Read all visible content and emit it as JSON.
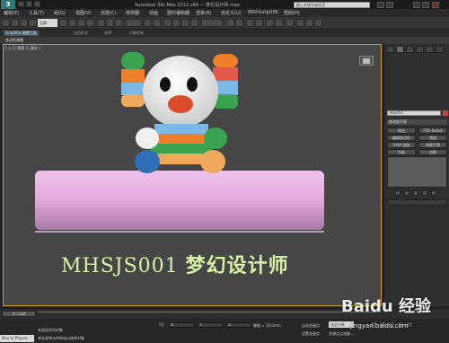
{
  "app": {
    "logo": "3",
    "title": "Autodesk 3ds Max 2012 x64 — 梦幻设计师.max",
    "search_placeholder": "键入关键字或短语"
  },
  "toolbar": {
    "selection_filter": "全部",
    "menus": [
      "编辑(E)",
      "工具(T)",
      "组(G)",
      "视图(V)",
      "创建(C)",
      "修改器",
      "动画",
      "图形编辑器",
      "渲染(R)",
      "自定义(U)",
      "MAXScript(M)",
      "帮助(H)"
    ]
  },
  "ribbon": {
    "tabs": [
      "Graphite 建模工具",
      "自由形式",
      "选择",
      "对象绘制"
    ],
    "sub_label": "多边形建模"
  },
  "viewport": {
    "label": "[ + ] [ 透视 ] [ 真实 ]",
    "overlay_text_latin": "MHSJS001",
    "overlay_text_cn": "梦幻设计师"
  },
  "command_panel": {
    "object_name": "Box001",
    "modifier_list": "修改器列表",
    "buttons": [
      "挤出",
      "FFD 4x4x4",
      "编辑多边形",
      "弯曲",
      "UVW 贴图",
      "网格平滑",
      "车削",
      "对称"
    ]
  },
  "timeline": {
    "frame_counter": "0 / 100"
  },
  "status": {
    "maxscript": "Max to Physac",
    "selected": "未选定任何对象",
    "prompt": "单击或单击并拖动以选择对象",
    "x_value": "X:",
    "y_value": "Y:",
    "z_value": "Z:",
    "grid": "栅格 = 10.0mm",
    "auto_key": "自动关键点",
    "selected_obj": "选定对象",
    "set_key": "设置关键点",
    "key_filter": "关键点过滤器..."
  },
  "watermark": {
    "logo_text": "Baidu 经验",
    "url": "jingyan.baidu.com"
  },
  "colors": {
    "viewport_border": "#d1a31d",
    "overlay_text": "#d9f2a5",
    "cylinder": "#e2a9dd"
  }
}
